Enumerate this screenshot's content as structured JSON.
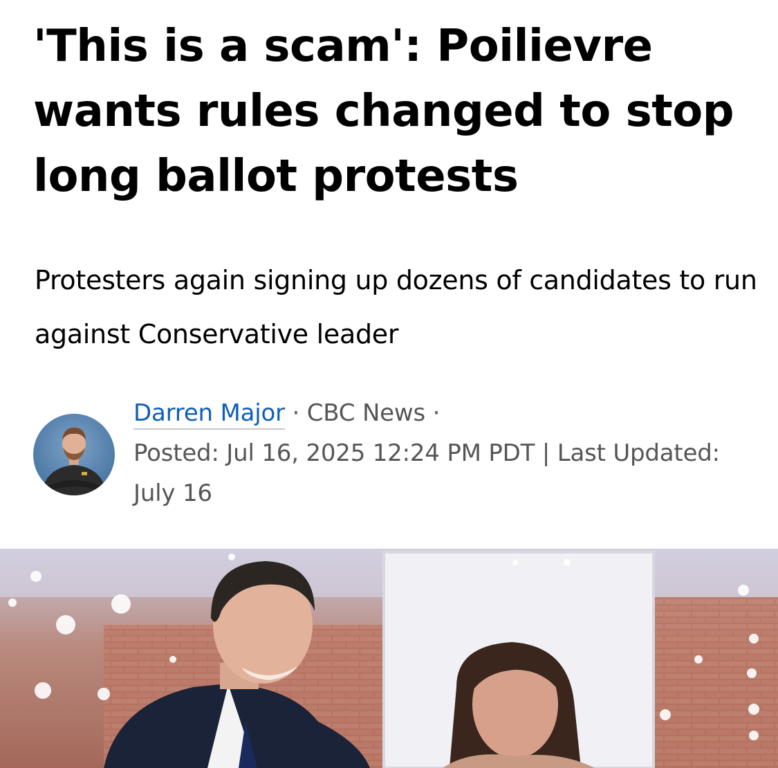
{
  "article": {
    "headline": "'This is a scam': Poilievre wants rules changed to stop long ballot protests",
    "dek": "Protesters again signing up dozens of candidates to run against Conservative leader",
    "byline": {
      "author": "Darren Major",
      "separator": " · ",
      "outlet": "CBC News",
      "trailing_separator": " ·",
      "posted": "Posted: Jul 16, 2025 12:24 PM PDT",
      "divider": " | ",
      "updated": "Last Updated: July 16"
    },
    "author_photo_icon": "author-avatar",
    "hero_image_icon": "news-photo"
  },
  "colors": {
    "link": "#0d5fb8",
    "meta": "#555555",
    "text": "#000000",
    "background": "#ffffff"
  }
}
